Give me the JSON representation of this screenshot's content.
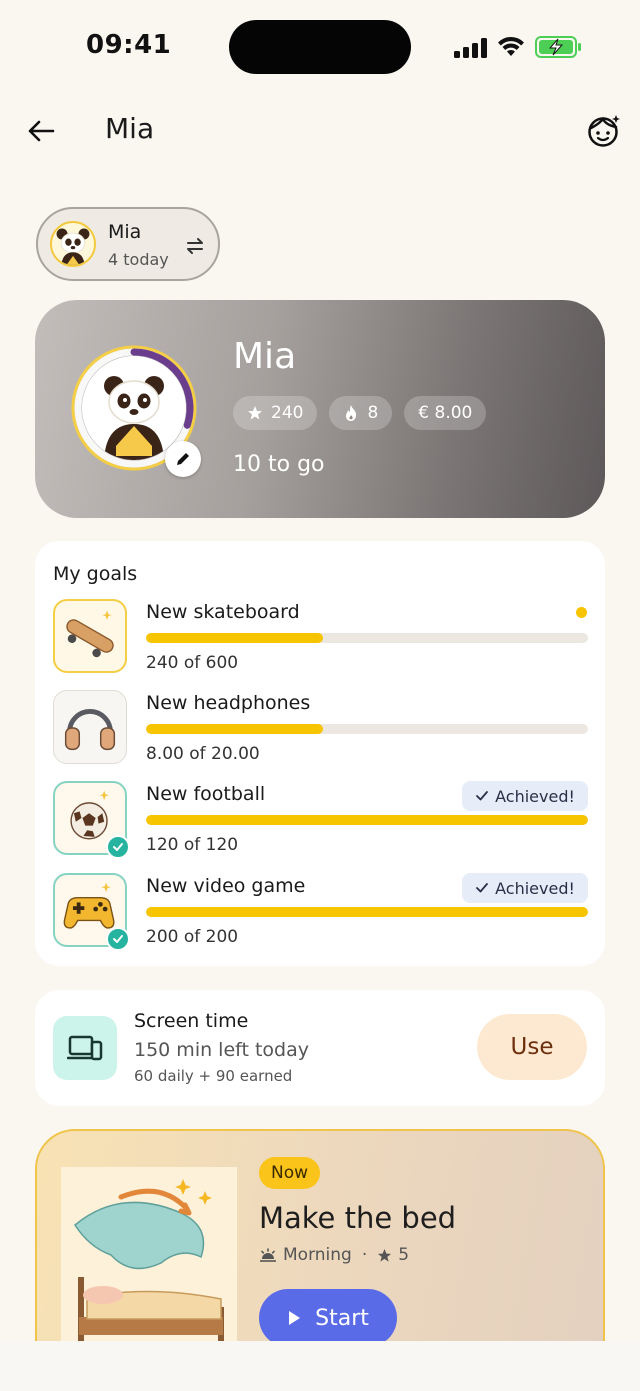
{
  "status_bar": {
    "time": "09:41"
  },
  "header": {
    "title": "Mia"
  },
  "profile_switch": {
    "name": "Mia",
    "subtitle": "4 today"
  },
  "hero": {
    "name": "Mia",
    "stats": {
      "stars": "240",
      "streak": "8",
      "money": "€ 8.00"
    },
    "to_go": "10 to go",
    "progress_fraction": 0.3
  },
  "goals": {
    "title": "My goals",
    "items": [
      {
        "name": "New skateboard",
        "value": "240 of 600",
        "progress": 0.4,
        "achieved": false,
        "dot": true,
        "icon": "skateboard-icon"
      },
      {
        "name": "New headphones",
        "value": "8.00 of 20.00",
        "progress": 0.4,
        "achieved": false,
        "dot": false,
        "icon": "headphones-icon"
      },
      {
        "name": "New football",
        "value": "120 of 120",
        "progress": 1.0,
        "achieved": true,
        "badge": "Achieved!",
        "icon": "football-icon"
      },
      {
        "name": "New video game",
        "value": "200 of 200",
        "progress": 1.0,
        "achieved": true,
        "badge": "Achieved!",
        "icon": "gamepad-icon"
      }
    ]
  },
  "screen_time": {
    "title": "Screen time",
    "left": "150 min left today",
    "sub": "60 daily + 90 earned",
    "button": "Use"
  },
  "task": {
    "badge": "Now",
    "title": "Make the bed",
    "time": "Morning",
    "stars": "5",
    "button": "Start"
  },
  "colors": {
    "accent_yellow": "#f7c400",
    "teal": "#26b3a0",
    "start_blue": "#5a6be8",
    "use_bg": "#fde9d2"
  }
}
